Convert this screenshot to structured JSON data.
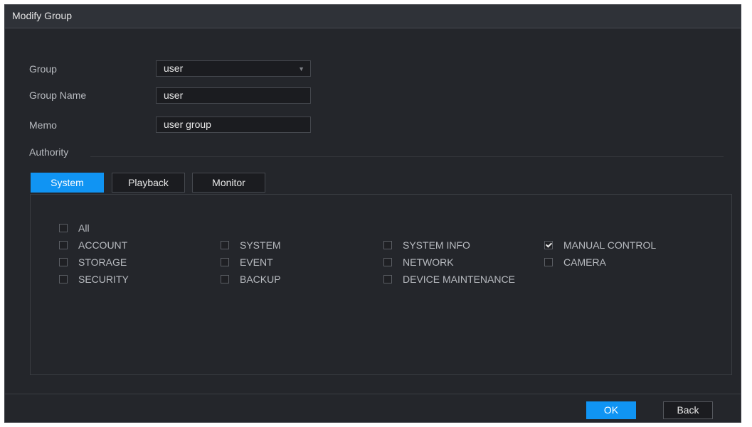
{
  "dialog": {
    "title": "Modify Group",
    "group_label": "Group",
    "group_value": "user",
    "group_name_label": "Group Name",
    "group_name_value": "user",
    "memo_label": "Memo",
    "memo_value": "user group",
    "authority_label": "Authority"
  },
  "tabs": [
    "System",
    "Playback",
    "Monitor"
  ],
  "checkboxes": {
    "all": {
      "label": "All",
      "checked": false
    },
    "items": [
      {
        "label": "ACCOUNT",
        "checked": false
      },
      {
        "label": "SYSTEM",
        "checked": false
      },
      {
        "label": "SYSTEM INFO",
        "checked": false
      },
      {
        "label": "MANUAL CONTROL",
        "checked": true
      },
      {
        "label": "STORAGE",
        "checked": false
      },
      {
        "label": "EVENT",
        "checked": false
      },
      {
        "label": "NETWORK",
        "checked": false
      },
      {
        "label": "CAMERA",
        "checked": false
      },
      {
        "label": "SECURITY",
        "checked": false
      },
      {
        "label": "BACKUP",
        "checked": false
      },
      {
        "label": "DEVICE MAINTENANCE",
        "checked": false
      }
    ]
  },
  "buttons": {
    "ok": "OK",
    "back": "Back"
  },
  "colors": {
    "accent": "#1094f3",
    "background": "#24262b"
  }
}
